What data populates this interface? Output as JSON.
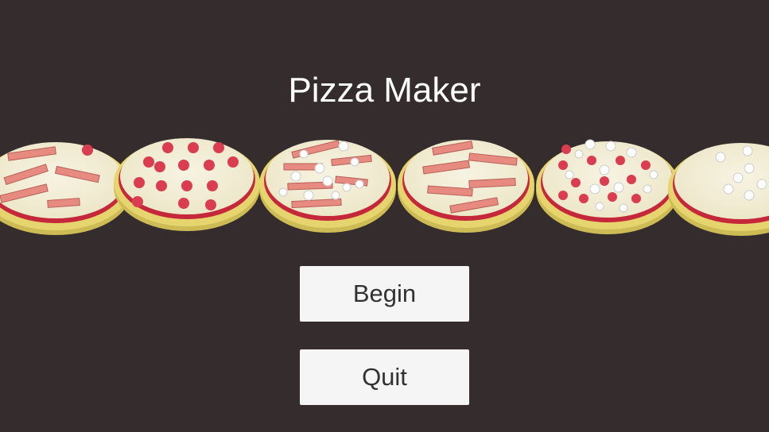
{
  "title": "Pizza Maker",
  "menu": {
    "begin_label": "Begin",
    "quit_label": "Quit"
  },
  "pizzas": [
    {
      "topping": "bacon"
    },
    {
      "topping": "pepperoni"
    },
    {
      "topping": "bacon-and-mushroom"
    },
    {
      "topping": "bacon"
    },
    {
      "topping": "pepperoni-and-mushroom"
    },
    {
      "topping": "mushroom"
    }
  ],
  "colors": {
    "background": "#352c2d",
    "crust": "#e6d46e",
    "cheese": "#f4f0da",
    "sauce": "#c4283a",
    "pepperoni": "#d93d4f",
    "bacon": "#e78a80",
    "mushroom": "#ffffff",
    "button": "#f5f5f5",
    "button_text": "#323232",
    "title_text": "#ffffff"
  }
}
